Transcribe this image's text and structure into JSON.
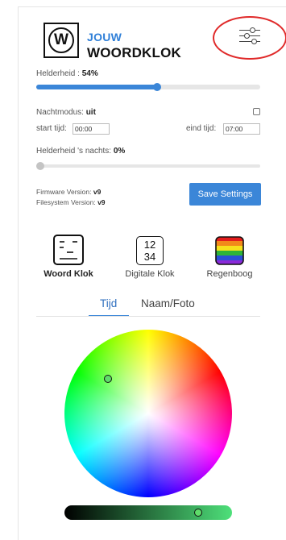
{
  "header": {
    "logo_letter": "W",
    "logo_line1": "JOUW",
    "logo_line2": "WOORDKLOK",
    "settings_icon": "sliders-icon",
    "highlight_color": "#e02a2a"
  },
  "brightness": {
    "label": "Helderheid : ",
    "value": "54%",
    "level": 0.54
  },
  "night_mode": {
    "label": "Nachtmodus: ",
    "state": "uit",
    "checked": false,
    "start_label": "start tijd:",
    "start_value": "00:00",
    "end_label": "eind tijd:",
    "end_value": "07:00",
    "brightness_label": "Helderheid 's nachts: ",
    "brightness_value": "0%",
    "brightness_level": 0.0
  },
  "versions": {
    "firmware_label": "Firmware Version: ",
    "firmware_value": "v9",
    "filesystem_label": "Filesystem Version: ",
    "filesystem_value": "v9"
  },
  "save_button": "Save Settings",
  "modes": [
    {
      "label": "Woord Klok",
      "icon": "word-clock-icon",
      "active": true
    },
    {
      "label": "Digitale Klok",
      "icon": "digital-clock-icon",
      "digits_top": "12",
      "digits_bottom": "34",
      "active": false
    },
    {
      "label": "Regenboog",
      "icon": "rainbow-icon",
      "active": false
    }
  ],
  "tabs": [
    {
      "label": "Tijd",
      "active": true
    },
    {
      "label": "Naam/Foto",
      "active": false
    }
  ],
  "color_picker": {
    "selected_color": "#5fdc6a",
    "value_level": 0.8
  },
  "colors": {
    "accent": "#3b86d8",
    "logo_accent": "#2f7fd8"
  }
}
